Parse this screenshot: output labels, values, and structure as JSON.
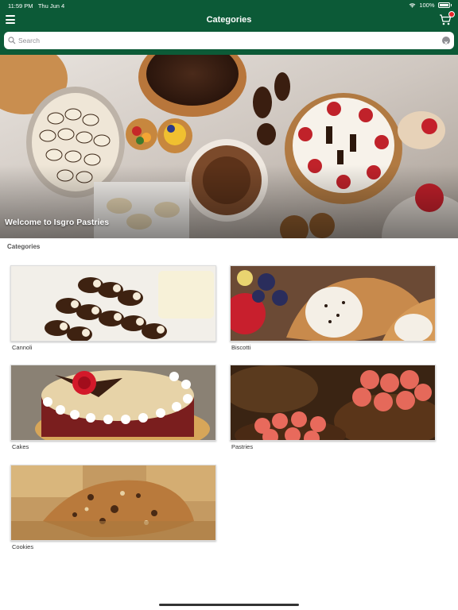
{
  "status_bar": {
    "time": "11:59 PM",
    "date": "Thu Jun 4",
    "battery": "100%"
  },
  "nav": {
    "title": "Categories",
    "menu_icon": "hamburger-icon",
    "cart_icon": "cart-icon"
  },
  "search": {
    "placeholder": "Search",
    "value": ""
  },
  "hero": {
    "caption": "Welcome to Isgro Pastries"
  },
  "section": {
    "label": "Categories"
  },
  "categories": [
    {
      "label": "Cannoli"
    },
    {
      "label": "Biscotti"
    },
    {
      "label": "Cakes"
    },
    {
      "label": "Pastries"
    },
    {
      "label": "Cookies"
    }
  ],
  "colors": {
    "header_green": "#0c5a37",
    "badge_red": "#e8262a"
  }
}
